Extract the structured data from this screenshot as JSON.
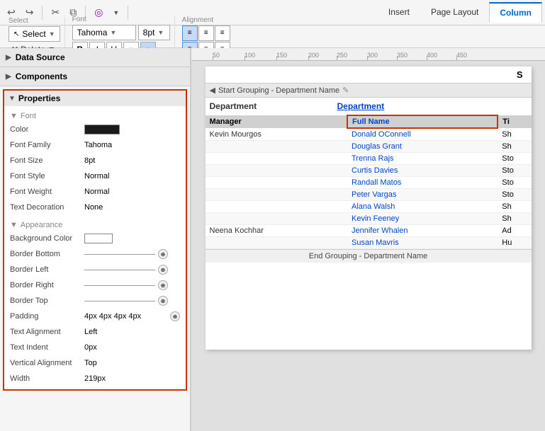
{
  "toolbar": {
    "undo_icon": "↩",
    "redo_icon": "↪",
    "cut_icon": "✂",
    "copy_icon": "⧉",
    "special_icon": "◎",
    "tabs": [
      "Insert",
      "Page Layout",
      "Column"
    ],
    "active_tab": "Column"
  },
  "toolbar2": {
    "select_label": "Select",
    "select_btn": "Select",
    "delete_btn": "Delete",
    "font_label": "Font",
    "font_value": "Tahoma",
    "size_value": "8pt",
    "alignment_label": "Alignment",
    "bold": "B",
    "italic": "I",
    "underline": "U"
  },
  "left": {
    "data_source_label": "Data Source",
    "components_label": "Components",
    "properties_label": "Properties",
    "font_group": "Font",
    "appearance_group": "Appearance",
    "props": {
      "color_label": "Color",
      "font_family_label": "Font Family",
      "font_family_value": "Tahoma",
      "font_size_label": "Font Size",
      "font_size_value": "8pt",
      "font_style_label": "Font Style",
      "font_style_value": "Normal",
      "font_weight_label": "Font Weight",
      "font_weight_value": "Normal",
      "text_decoration_label": "Text Decoration",
      "text_decoration_value": "None",
      "bg_color_label": "Background Color",
      "border_bottom_label": "Border Bottom",
      "border_left_label": "Border Left",
      "border_right_label": "Border Right",
      "border_top_label": "Border Top",
      "padding_label": "Padding",
      "padding_value": "4px 4px 4px 4px",
      "text_align_label": "Text Alignment",
      "text_align_value": "Left",
      "text_indent_label": "Text Indent",
      "text_indent_value": "0px",
      "vertical_align_label": "Vertical Alignment",
      "vertical_align_value": "Top",
      "width_label": "Width",
      "width_value": "219px"
    }
  },
  "report": {
    "header_text": "S",
    "group_header": "Start Grouping - Department Name",
    "dept_col1": "Department",
    "dept_col2": "Department",
    "col_manager": "Manager",
    "col_fullname": "Full Name",
    "col_title": "Ti",
    "rows": [
      {
        "manager": "Kevin Mourgos",
        "fullname": "Donald OConnell",
        "title": "Sh"
      },
      {
        "manager": "",
        "fullname": "Douglas Grant",
        "title": "Sh"
      },
      {
        "manager": "",
        "fullname": "Trenna Rajs",
        "title": "Sto"
      },
      {
        "manager": "",
        "fullname": "Curtis Davies",
        "title": "Sto"
      },
      {
        "manager": "",
        "fullname": "Randall Matos",
        "title": "Sto"
      },
      {
        "manager": "",
        "fullname": "Peter Vargas",
        "title": "Sto"
      },
      {
        "manager": "",
        "fullname": "Alana Walsh",
        "title": "Sh"
      },
      {
        "manager": "",
        "fullname": "Kevin Feeney",
        "title": "Sh"
      },
      {
        "manager": "Neena Kochhar",
        "fullname": "Jennifer Whalen",
        "title": "Ad"
      },
      {
        "manager": "",
        "fullname": "Susan Mavris",
        "title": "Hu"
      }
    ],
    "end_group": "End Grouping - Department Name"
  },
  "ruler": {
    "marks": [
      "50",
      "100",
      "150",
      "200",
      "250",
      "300",
      "350",
      "400",
      "450"
    ]
  },
  "colors": {
    "selected_border": "#cc3300",
    "tab_active": "#0066cc",
    "link_blue": "#0044cc"
  }
}
